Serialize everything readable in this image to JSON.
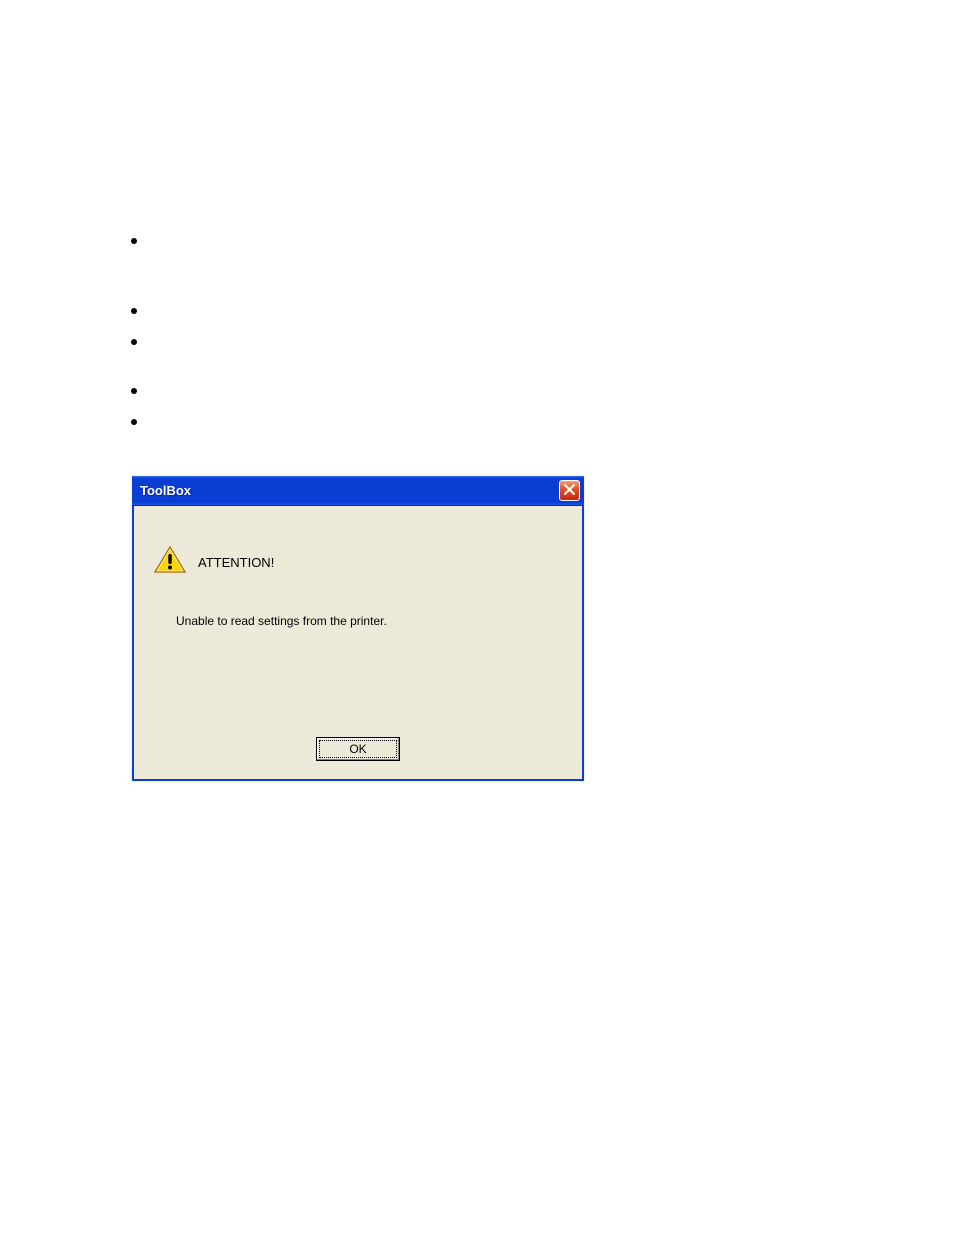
{
  "dialog": {
    "title": "ToolBox",
    "attention_label": "ATTENTION!",
    "message": "Unable to read settings from the printer.",
    "ok_label": "OK"
  }
}
